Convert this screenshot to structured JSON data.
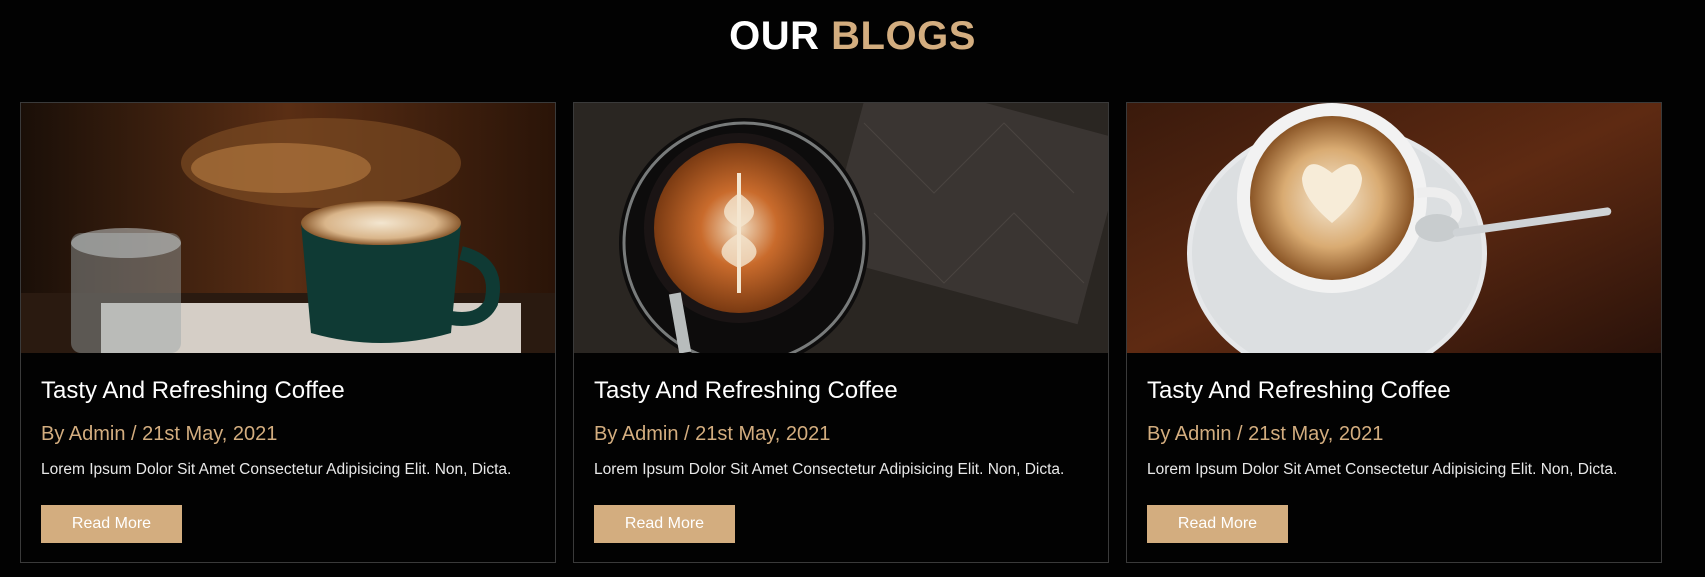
{
  "section": {
    "title_part1": "OUR",
    "title_part2": "BLOGS"
  },
  "colors": {
    "accent": "#d3ad7f",
    "background": "#020202",
    "border": "#3a3a3a"
  },
  "blogs": [
    {
      "title": "Tasty And Refreshing Coffee",
      "meta": "By Admin / 21st May, 2021",
      "excerpt": "Lorem Ipsum Dolor Sit Amet Consectetur Adipisicing Elit. Non, Dicta.",
      "button": "Read More",
      "image": "green-cup-latte-art-photo"
    },
    {
      "title": "Tasty And Refreshing Coffee",
      "meta": "By Admin / 21st May, 2021",
      "excerpt": "Lorem Ipsum Dolor Sit Amet Consectetur Adipisicing Elit. Non, Dicta.",
      "button": "Read More",
      "image": "top-view-latte-art-photo"
    },
    {
      "title": "Tasty And Refreshing Coffee",
      "meta": "By Admin / 21st May, 2021",
      "excerpt": "Lorem Ipsum Dolor Sit Amet Consectetur Adipisicing Elit. Non, Dicta.",
      "button": "Read More",
      "image": "white-cup-heart-latte-photo"
    }
  ]
}
